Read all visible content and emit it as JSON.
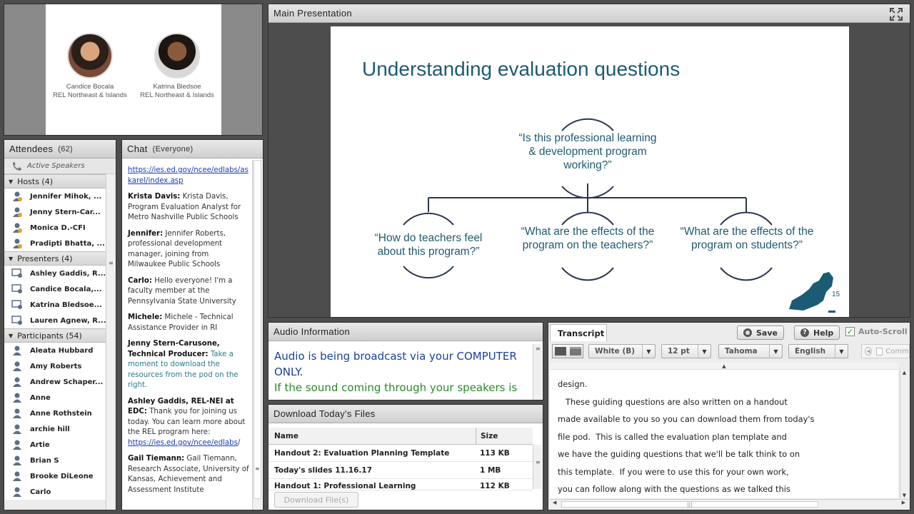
{
  "camera": {
    "speakers": [
      {
        "name": "Candice Bocala",
        "org": "REL Northeast & Islands"
      },
      {
        "name": "Katrina Bledsoe",
        "org": "REL Northeast & Islands"
      }
    ]
  },
  "attendees": {
    "title": "Attendees",
    "count": "(62)",
    "active_speakers": "Active Speakers",
    "hosts_label": "Hosts (4)",
    "hosts": [
      "Jennifer Mihok, ...",
      "Jenny Stern-Car...",
      "Monica D.-CFI",
      "Pradipti Bhatta, ..."
    ],
    "presenters_label": "Presenters (4)",
    "presenters": [
      "Ashley Gaddis, R...",
      "Candice Bocala,...",
      "Katrina Bledsoe...",
      "Lauren Agnew, R..."
    ],
    "participants_label": "Participants (54)",
    "participants": [
      "Aleata Hubbard",
      "Amy Roberts",
      "Andrew Schaper...",
      "Anne",
      "Anne Rothstein",
      "archie hill",
      "Artie",
      "Brian S",
      "Brooke DiLeone",
      "Carlo"
    ]
  },
  "chat": {
    "title": "Chat",
    "scope": "(Everyone)",
    "link1": "https://ies.ed.gov/ncee/edlabs/askarel/index.asp",
    "link1_display_a": "https://ies.ed.gov/ncee/edlabs/as",
    "link1_display_b": "karel/index.asp",
    "messages": [
      {
        "sender": "Krista Davis:",
        "text": " Krista Davis, Program Evaluation Analyst for Metro Nashville Public Schools"
      },
      {
        "sender": "Jennifer:",
        "text": " Jennifer Roberts, professional development manager, joining from Milwaukee Public Schools"
      },
      {
        "sender": "Carlo:",
        "text": " Hello everyone! I'm a faculty member at the Pennsylvania State University"
      },
      {
        "sender": "Michele:",
        "text": " Michele - Technical Assistance Provider in RI"
      },
      {
        "sender": "Jenny Stern-Carusone, Technical Producer:",
        "text": " Take a moment to download the resources from the pod on the right."
      },
      {
        "sender": "Ashley Gaddis, REL-NEI at EDC:",
        "text": " Thank you for joining us today. You can learn more about the REL program here: "
      },
      {
        "sender": "Gail Tiemann:",
        "text": " Gail Tiemann, Research Associate, University of Kansas, Achievement and Assessment Institute"
      }
    ],
    "link2": "https://ies.ed.gov/ncee/edlabs",
    "link2_suffix": "/"
  },
  "main": {
    "title": "Main Presentation",
    "slide_title": "Understanding evaluation questions",
    "q_top": "“Is this professional learning & development program working?”",
    "q_left": "“How do teachers feel about this program?”",
    "q_mid": "“What are the effects of the program on the teachers?”",
    "q_right": "“What are the effects of the program on students?”",
    "page_number": "15"
  },
  "audio": {
    "title": "Audio Information",
    "line1": "Audio is being broadcast via your COMPUTER ONLY.",
    "line2": "If the sound coming through your speakers is"
  },
  "files": {
    "title": "Download Today's Files",
    "col_name": "Name",
    "col_size": "Size",
    "rows": [
      {
        "name": "Handout 2: Evaluation Planning Template",
        "size": "113 KB"
      },
      {
        "name": "Today's slides 11.16.17",
        "size": "1 MB"
      },
      {
        "name": "Handout 1: Professional Learning",
        "size": "112 KB"
      }
    ],
    "download_button": "Download File(s)"
  },
  "transcript": {
    "tab": "Transcript",
    "save": "Save",
    "help": "Help",
    "autoscroll": "Auto-Scroll",
    "color": "White (B)",
    "size": "12 pt",
    "font": "Tahoma",
    "language": "English",
    "comm": "Comm",
    "lines": [
      "design.",
      "   These guiding questions are also written on a handout",
      "made available to you so you can download them from today's",
      "file pod.  This is called the evaluation plan template and",
      "we have the guiding questions that we'll be talk think to on",
      "this template.  If you were to use this for your own work,",
      "you can follow along with the questions as we talked this"
    ]
  },
  "colors": {
    "slide_teal": "#1b5b73",
    "link_blue": "#1a3cb5",
    "audio_blue": "#1b3f9e",
    "audio_green": "#2a8a2a"
  }
}
